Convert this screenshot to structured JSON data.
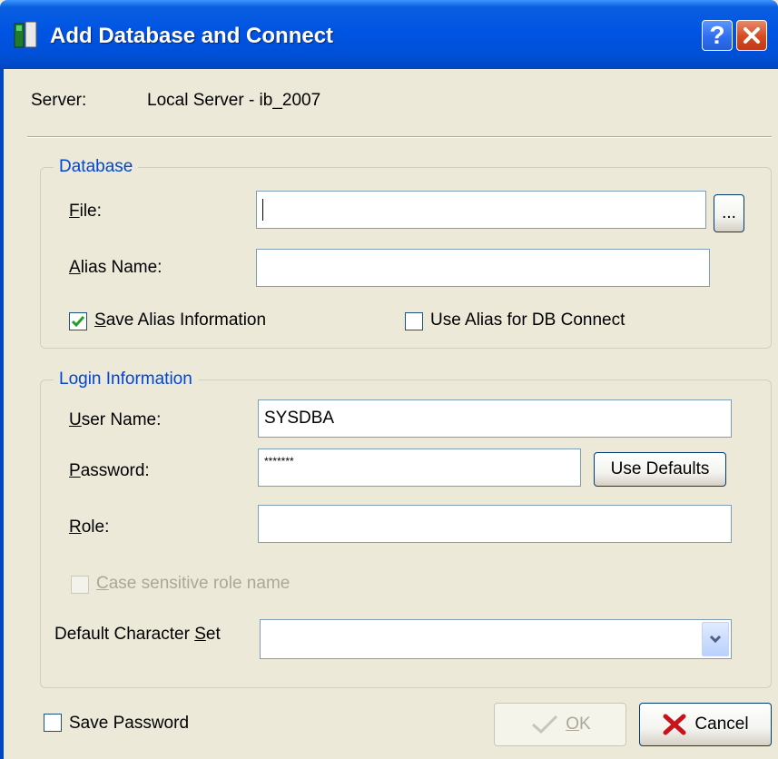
{
  "window": {
    "title": "Add Database and Connect",
    "help_button": "?",
    "close_icon": "close-icon"
  },
  "server": {
    "label": "Server:",
    "value": "Local Server - ib_2007"
  },
  "database_group": {
    "title": "Database",
    "file_label_underlined": "F",
    "file_label_rest": "ile:",
    "file_value": "",
    "browse_label": "...",
    "alias_label_underlined": "A",
    "alias_label_rest": "lias Name:",
    "alias_value": "",
    "save_alias_underlined": "S",
    "save_alias_rest": "ave Alias Information",
    "save_alias_checked": true,
    "use_alias_label": "Use Alias for DB Connect",
    "use_alias_checked": false
  },
  "login_group": {
    "title": "Login Information",
    "user_label_underlined": "U",
    "user_label_rest": "ser Name:",
    "user_value": "SYSDBA",
    "password_label_underlined": "P",
    "password_label_rest": "assword:",
    "password_value": "*******",
    "use_defaults_label": "Use Defaults",
    "role_label_underlined": "R",
    "role_label_rest": "ole:",
    "role_value": "",
    "case_sensitive_underlined": "C",
    "case_sensitive_rest": "ase sensitive role name",
    "case_sensitive_checked": false,
    "charset_label_prefix": "Default Character ",
    "charset_label_underlined": "S",
    "charset_label_rest": "et",
    "charset_value": ""
  },
  "footer": {
    "save_password_label": "Save Password",
    "save_password_checked": false,
    "ok_underlined": "O",
    "ok_rest": "K",
    "cancel_label": "Cancel"
  },
  "colors": {
    "titlebar": "#0054e3",
    "dialog_bg": "#ece9d8",
    "group_title": "#0046d5",
    "check_mark": "#21a121",
    "cancel_x": "#c8121c"
  }
}
